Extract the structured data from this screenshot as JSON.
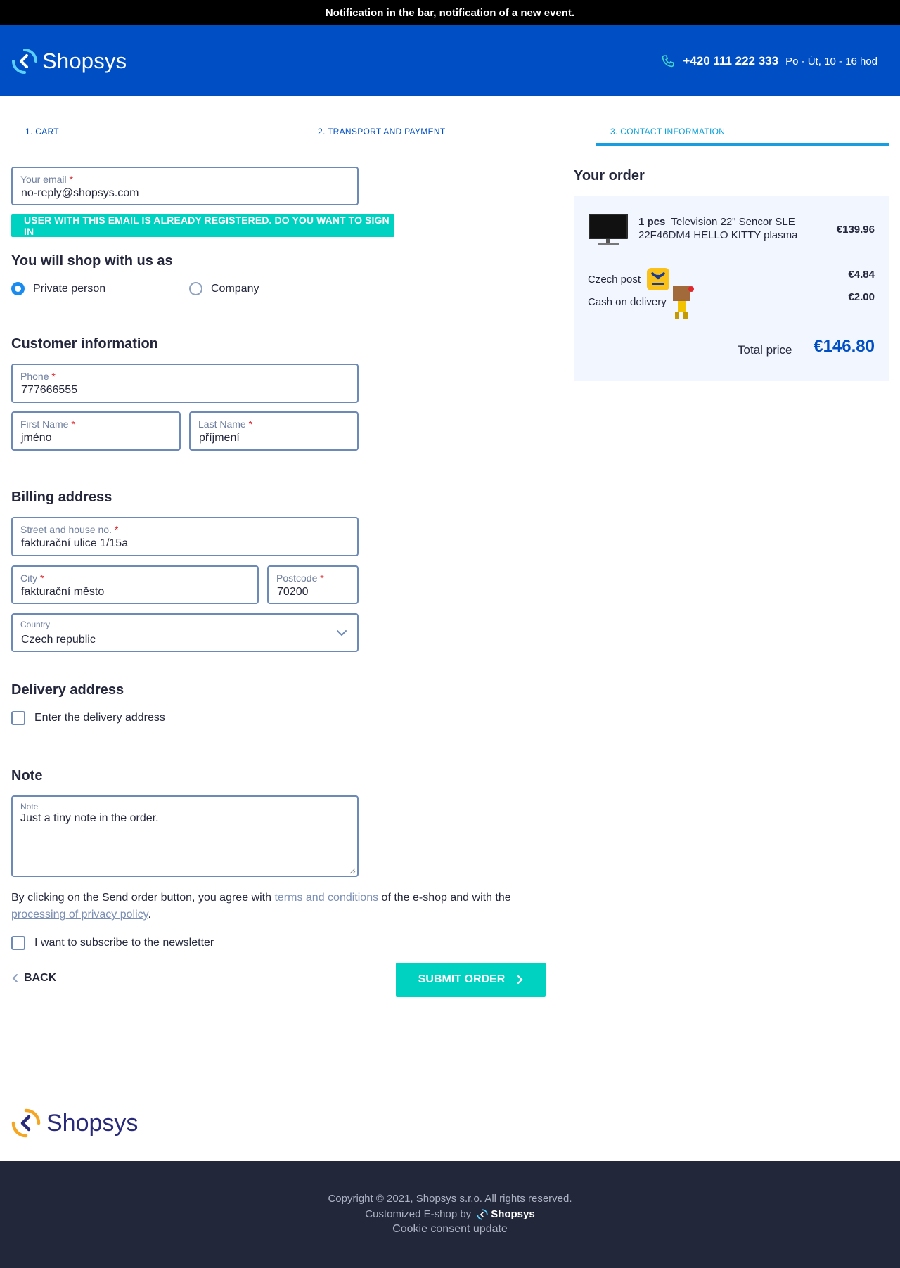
{
  "notification": "Notification in the bar, notification of a new event.",
  "header": {
    "logo_text": "Shopsys",
    "phone": "+420 111 222 333",
    "hours": "Po - Út, 10 - 16 hod"
  },
  "steps": [
    {
      "label": "1. CART"
    },
    {
      "label": "2. TRANSPORT AND PAYMENT"
    },
    {
      "label": "3. CONTACT INFORMATION"
    }
  ],
  "email": {
    "label": "Your email",
    "required": "*",
    "value": "no-reply@shopsys.com"
  },
  "email_alert": "USER WITH THIS EMAIL IS ALREADY REGISTERED. DO YOU WANT TO SIGN IN",
  "shop_as": {
    "heading": "You will shop with us as",
    "options": [
      {
        "label": "Private person",
        "selected": true
      },
      {
        "label": "Company",
        "selected": false
      }
    ]
  },
  "customer": {
    "heading": "Customer information",
    "phone": {
      "label": "Phone",
      "required": "*",
      "value": "777666555"
    },
    "first_name": {
      "label": "First Name",
      "required": "*",
      "value": "jméno"
    },
    "last_name": {
      "label": "Last Name",
      "required": "*",
      "value": "příjmení"
    }
  },
  "billing": {
    "heading": "Billing address",
    "street": {
      "label": "Street and house no.",
      "required": "*",
      "value": "fakturační ulice 1/15a"
    },
    "city": {
      "label": "City",
      "required": "*",
      "value": "fakturační město"
    },
    "postcode": {
      "label": "Postcode",
      "required": "*",
      "value": "70200"
    },
    "country": {
      "label": "Country",
      "value": "Czech republic"
    }
  },
  "delivery": {
    "heading": "Delivery address",
    "checkbox_label": "Enter the delivery address"
  },
  "note": {
    "heading": "Note",
    "label": "Note",
    "value": "Just a tiny note in the order."
  },
  "agreement": {
    "part1": "By clicking on the Send order button, you agree with ",
    "link1": "terms and conditions",
    "part2": " of the e-shop and with the ",
    "link2": "processing of privacy policy",
    "part3": "."
  },
  "newsletter_label": "I want to subscribe to the newsletter",
  "buttons": {
    "back": "BACK",
    "submit": "SUBMIT ORDER"
  },
  "order": {
    "title": "Your order",
    "item": {
      "qty": "1 pcs",
      "name": "Television 22\" Sencor SLE 22F46DM4 HELLO KITTY plasma",
      "price": "€139.96"
    },
    "transport": {
      "name": "Czech post",
      "price": "€4.84"
    },
    "payment": {
      "name": "Cash on delivery",
      "price": "€2.00"
    },
    "total_label": "Total price",
    "total": "€146.80"
  },
  "footer": {
    "logo_text": "Shopsys",
    "copyright": "Copyright © 2021, Shopsys s.r.o. All rights reserved.",
    "customized": "Customized E-shop by",
    "brand": "Shopsys",
    "cookie": "Cookie consent update"
  },
  "colors": {
    "brand_blue": "#004ec4",
    "accent_teal": "#00d2c1",
    "footer_bg": "#23273a"
  }
}
